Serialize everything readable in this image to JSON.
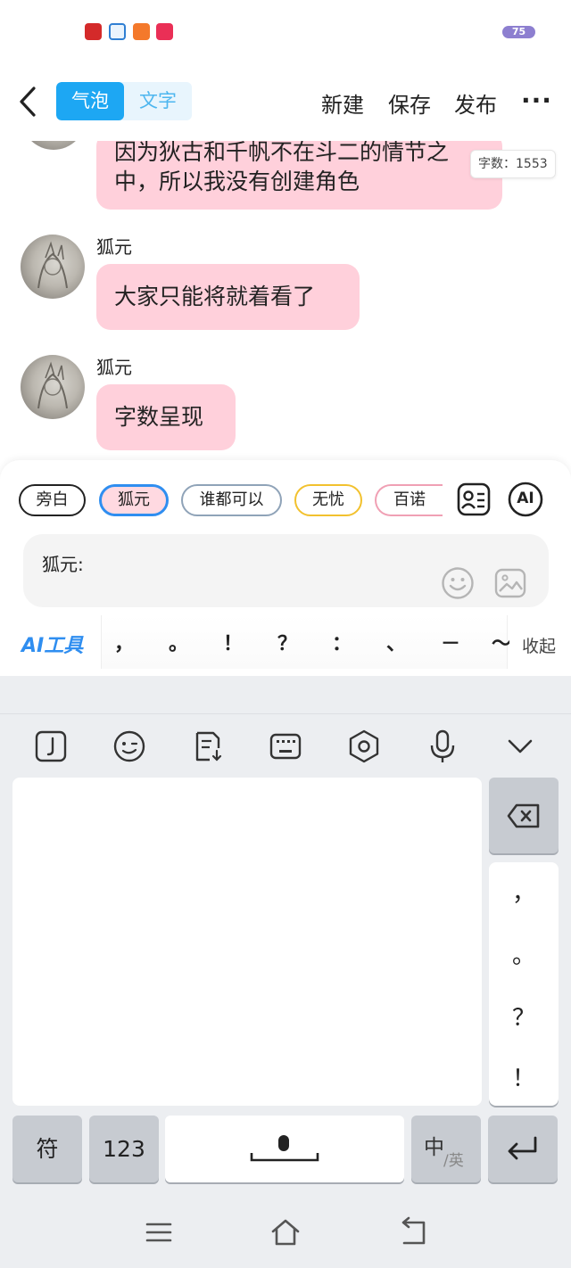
{
  "status_bar": {
    "battery": "75",
    "app_icons": [
      {
        "name": "app-icon-red",
        "color": "#d42a2a"
      },
      {
        "name": "app-icon-blue-100",
        "color": "#2f7fd3"
      },
      {
        "name": "app-icon-orange",
        "color": "#f4792b"
      },
      {
        "name": "app-icon-pink",
        "color": "#ea2f56"
      }
    ]
  },
  "header": {
    "tabs": [
      "气泡",
      "文字"
    ],
    "new_label": "新建",
    "save_label": "保存",
    "publish_label": "发布",
    "more_label": "···"
  },
  "chat": {
    "word_count": "字数：1553",
    "messages": [
      {
        "speaker": "",
        "text_lines": [
          "因为狄古和千帆不在斗二的情节之",
          "中，所以我没有创建角色"
        ]
      },
      {
        "speaker": "狐元",
        "text": "大家只能将就着看了"
      },
      {
        "speaker": "狐元",
        "text": "字数呈现"
      }
    ]
  },
  "compose": {
    "roles": [
      "旁白",
      "狐元",
      "谁都可以",
      "无忧",
      "百诺"
    ],
    "selected_role": "狐元",
    "role_colors": {
      "旁白": "#222222",
      "狐元": "#2f8ef0",
      "谁都可以": "#8fa3b8",
      "无忧": "#f2c12e",
      "百诺": "#f0a0b4"
    },
    "ai_button": "AI",
    "input_prefix": "狐元:",
    "ai_tools_label": "AI工具",
    "punctuation": [
      "，",
      "。",
      "！",
      "？",
      "：",
      "、",
      "－",
      "～"
    ],
    "collapse_label": "收起"
  },
  "keyboard": {
    "side_keys": [
      "，",
      "。",
      "？",
      "！"
    ],
    "symbol_key": "符",
    "number_key": "123",
    "lang_key_main": "中",
    "lang_key_sub": "/英"
  },
  "colors": {
    "accent_blue": "#1da7f3",
    "bubble_pink": "#ffd0db",
    "keyboard_bg": "#eceef1"
  }
}
